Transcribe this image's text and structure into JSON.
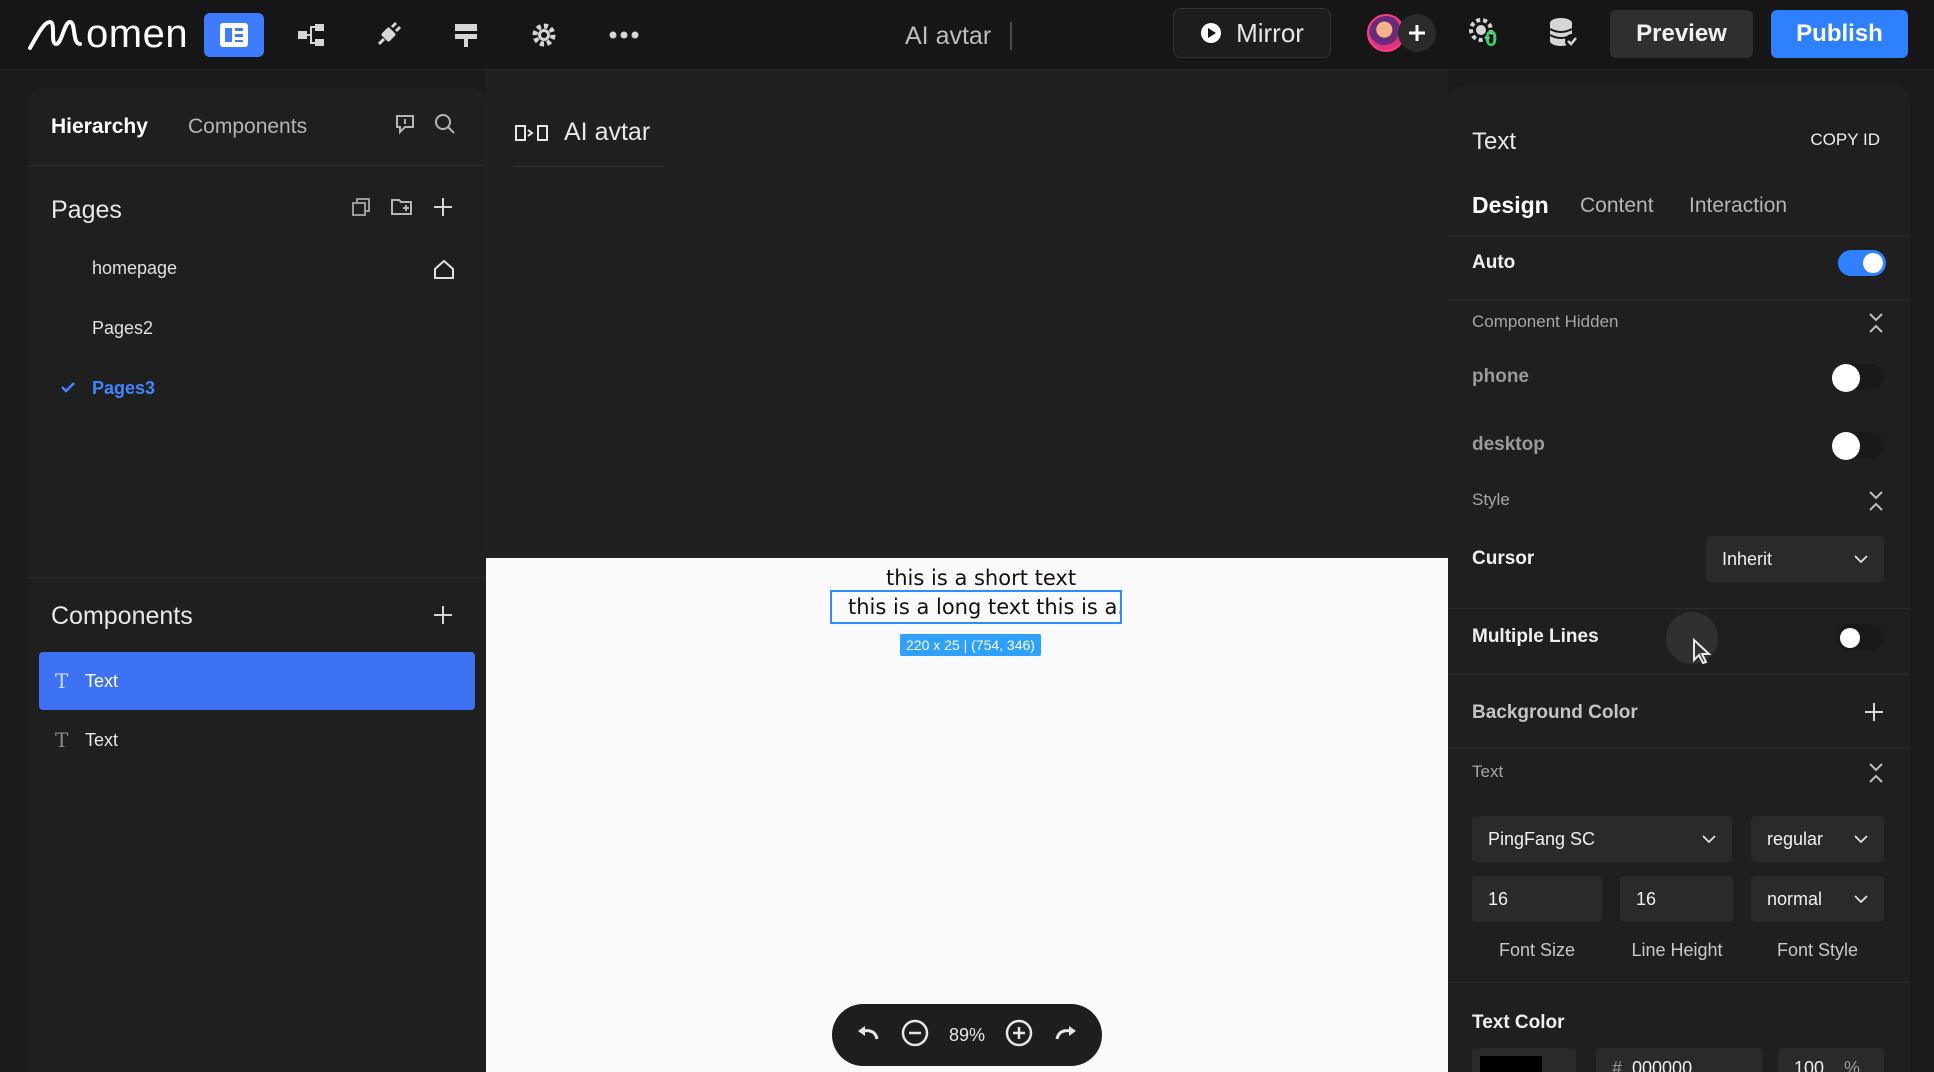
{
  "topbar": {
    "logo_text": "omen",
    "doc_title": "AI avtar",
    "mirror_label": "Mirror",
    "credit_count": "0",
    "preview_label": "Preview",
    "publish_label": "Publish",
    "accent_color": "#2f80ff"
  },
  "left_panel": {
    "tabs": [
      "Hierarchy",
      "Components"
    ],
    "pages_title": "Pages",
    "pages": [
      {
        "label": "homepage",
        "home": true
      },
      {
        "label": "Pages2"
      },
      {
        "label": "Pages3",
        "active": true
      }
    ],
    "components_title": "Components",
    "components": [
      {
        "label": "Text",
        "selected": true
      },
      {
        "label": "Text"
      }
    ]
  },
  "canvas": {
    "title": "AI avtar",
    "short_text": "this is a short text",
    "long_text": "this is a long text this is a...",
    "size_tag": "220 x 25 | (754, 346)",
    "zoom": "89%"
  },
  "right_panel": {
    "title": "Text",
    "copy_id": "COPY ID",
    "tabs": [
      "Design",
      "Content",
      "Interaction"
    ],
    "auto_label": "Auto",
    "auto_on": true,
    "component_hidden_label": "Component Hidden",
    "phone_label": "phone",
    "desktop_label": "desktop",
    "style_label": "Style",
    "cursor_label": "Cursor",
    "cursor_value": "Inherit",
    "multiple_lines_label": "Multiple Lines",
    "background_color_label": "Background Color",
    "text_group_label": "Text",
    "font_family": "PingFang SC",
    "font_weight": "regular",
    "font_size": "16",
    "line_height": "16",
    "font_style": "normal",
    "font_size_caption": "Font Size",
    "line_height_caption": "Line Height",
    "font_style_caption": "Font Style",
    "text_color_label": "Text Color",
    "text_color_hex": "000000",
    "text_color_hash": "#",
    "text_color_opacity": "100",
    "text_color_percent": "%"
  }
}
